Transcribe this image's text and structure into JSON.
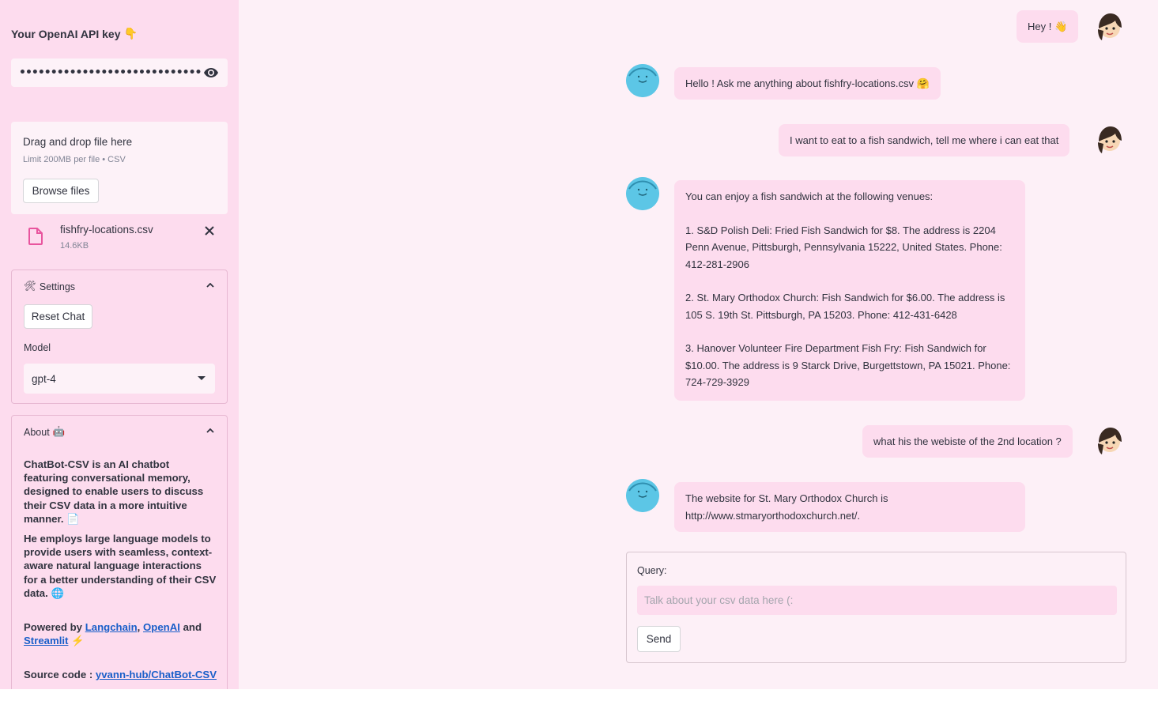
{
  "sidebar": {
    "api_key_label": "Your OpenAI API key",
    "api_key_emoji": "👇",
    "api_key_value": "••••••••••••••••••••••••••••••••••••••••••••••••••••",
    "uploader": {
      "title": "Drag and drop file here",
      "limit": "Limit 200MB per file • CSV",
      "browse_label": "Browse files"
    },
    "file": {
      "name": "fishfry-locations.csv",
      "size": "14.6KB"
    },
    "settings": {
      "title": "Settings",
      "emoji": "🛠",
      "reset_label": "Reset Chat",
      "model_label": "Model",
      "model_value": "gpt-4"
    },
    "about": {
      "title": "About",
      "emoji": "🤖",
      "p1": "ChatBot-CSV is an AI chatbot featuring conversational memory, designed to enable users to discuss their CSV data in a more intuitive manner. 📄",
      "p2": "He employs large language models to provide users with seamless, context-aware natural language interactions for a better understanding of their CSV data. 🌐",
      "powered_prefix": "Powered by",
      "link_langchain": "Langchain",
      "comma": ",",
      "link_openai": "OpenAI",
      "and": "and",
      "link_streamlit": "Streamlit",
      "powered_emoji": "⚡",
      "source_prefix": "Source code :",
      "link_source": "yvann-hub/ChatBot-CSV"
    }
  },
  "chat": {
    "messages": [
      {
        "role": "user",
        "text": "Hey ! 👋"
      },
      {
        "role": "bot",
        "text": "Hello ! Ask me anything about fishfry-locations.csv 🤗"
      },
      {
        "role": "user",
        "text": "I want to eat to a fish sandwich, tell me where i can eat that"
      },
      {
        "role": "bot",
        "lines": [
          "You can enjoy a fish sandwich at the following venues:",
          "1. S&D Polish Deli: Fried Fish Sandwich for $8. The address is 2204 Penn Avenue, Pittsburgh, Pennsylvania 15222, United States. Phone: 412-281-2906",
          "2. St. Mary Orthodox Church: Fish Sandwich for $6.00. The address is 105 S. 19th St. Pittsburgh, PA 15203. Phone: 412-431-6428",
          "3. Hanover Volunteer Fire Department Fish Fry: Fish Sandwich for $10.00. The address is 9 Starck Drive, Burgettstown, PA 15021. Phone: 724-729-3929"
        ]
      },
      {
        "role": "user",
        "text": "what his the webiste of the 2nd location ?"
      },
      {
        "role": "bot",
        "text": "The website for St. Mary Orthodox Church is http://www.stmaryorthodoxchurch.net/."
      }
    ],
    "form": {
      "query_label": "Query:",
      "query_placeholder": "Talk about your csv data here (:",
      "query_value": "",
      "send_label": "Send"
    }
  },
  "colors": {
    "sidebar_bg": "#fddcee",
    "main_bg": "#fdf0f7",
    "bubble_bg": "#fddcee",
    "bot_avatar": "#5cc6e6",
    "link": "#1a5fc9",
    "file_icon": "#e8559e"
  }
}
